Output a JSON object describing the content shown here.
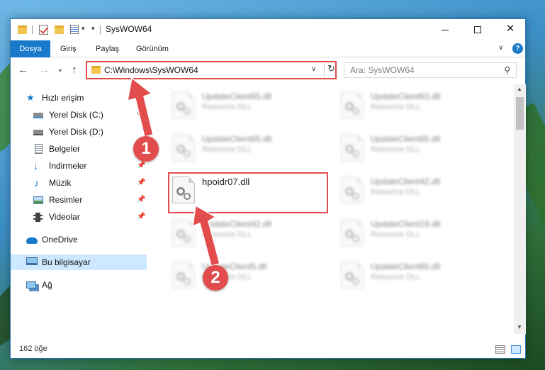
{
  "window": {
    "title": "SysWOW64",
    "minimize_glyph": "—",
    "close_glyph": "✕"
  },
  "ribbon": {
    "tabs": [
      "Dosya",
      "Giriş",
      "Paylaş",
      "Görünüm"
    ],
    "help_glyph": "?"
  },
  "nav": {
    "back_glyph": "←",
    "forward_glyph": "→",
    "recent_glyph": "▾",
    "up_glyph": "↑"
  },
  "address": {
    "path": "C:\\Windows\\SysWOW64",
    "dropdown_glyph": "∨",
    "refresh_glyph": "↻"
  },
  "search": {
    "placeholder": "Ara: SysWOW64"
  },
  "sidebar": {
    "items": [
      {
        "label": "Hızlı erişim",
        "icon": "star-icon"
      },
      {
        "label": "Yerel Disk (C:)",
        "icon": "drive-icon"
      },
      {
        "label": "Yerel Disk (D:)",
        "icon": "drive-icon"
      },
      {
        "label": "Belgeler",
        "icon": "documents-icon"
      },
      {
        "label": "İndirmeler",
        "icon": "download-icon"
      },
      {
        "label": "Müzik",
        "icon": "music-icon"
      },
      {
        "label": "Resimler",
        "icon": "pictures-icon"
      },
      {
        "label": "Videolar",
        "icon": "video-icon"
      },
      {
        "label": "OneDrive",
        "icon": "cloud-icon"
      },
      {
        "label": "Bu bilgisayar",
        "icon": "computer-icon"
      },
      {
        "label": "Ağ",
        "icon": "network-icon"
      }
    ]
  },
  "files": {
    "left": [
      {
        "name": "UpdateClient65.dll",
        "type": "Resource DLL"
      },
      {
        "name": "UpdateClient65.dll",
        "type": "Resource DLL"
      },
      {
        "name": "hpoidr07.dll",
        "type": ""
      },
      {
        "name": "UpdateClient42.dll",
        "type": "Resource DLL"
      },
      {
        "name": "UpdateClient5.dll",
        "type": "Resource DLL"
      }
    ],
    "right": [
      {
        "name": "UpdateClient63.dll",
        "type": "Resource DLL"
      },
      {
        "name": "UpdateClient65.dll",
        "type": "Resource DLL"
      },
      {
        "name": "UpdateClient42.dll",
        "type": "Resource DLL"
      },
      {
        "name": "UpdateClient19.dll",
        "type": "Resource DLL"
      },
      {
        "name": "UpdateClient65.dll",
        "type": "Resource DLL"
      }
    ]
  },
  "status": {
    "item_count": "162 öğe"
  },
  "annotations": {
    "step1": "1",
    "step2": "2",
    "color": "#e34c4c"
  },
  "colors": {
    "accent": "#1979ca",
    "selection": "#cde8ff"
  }
}
